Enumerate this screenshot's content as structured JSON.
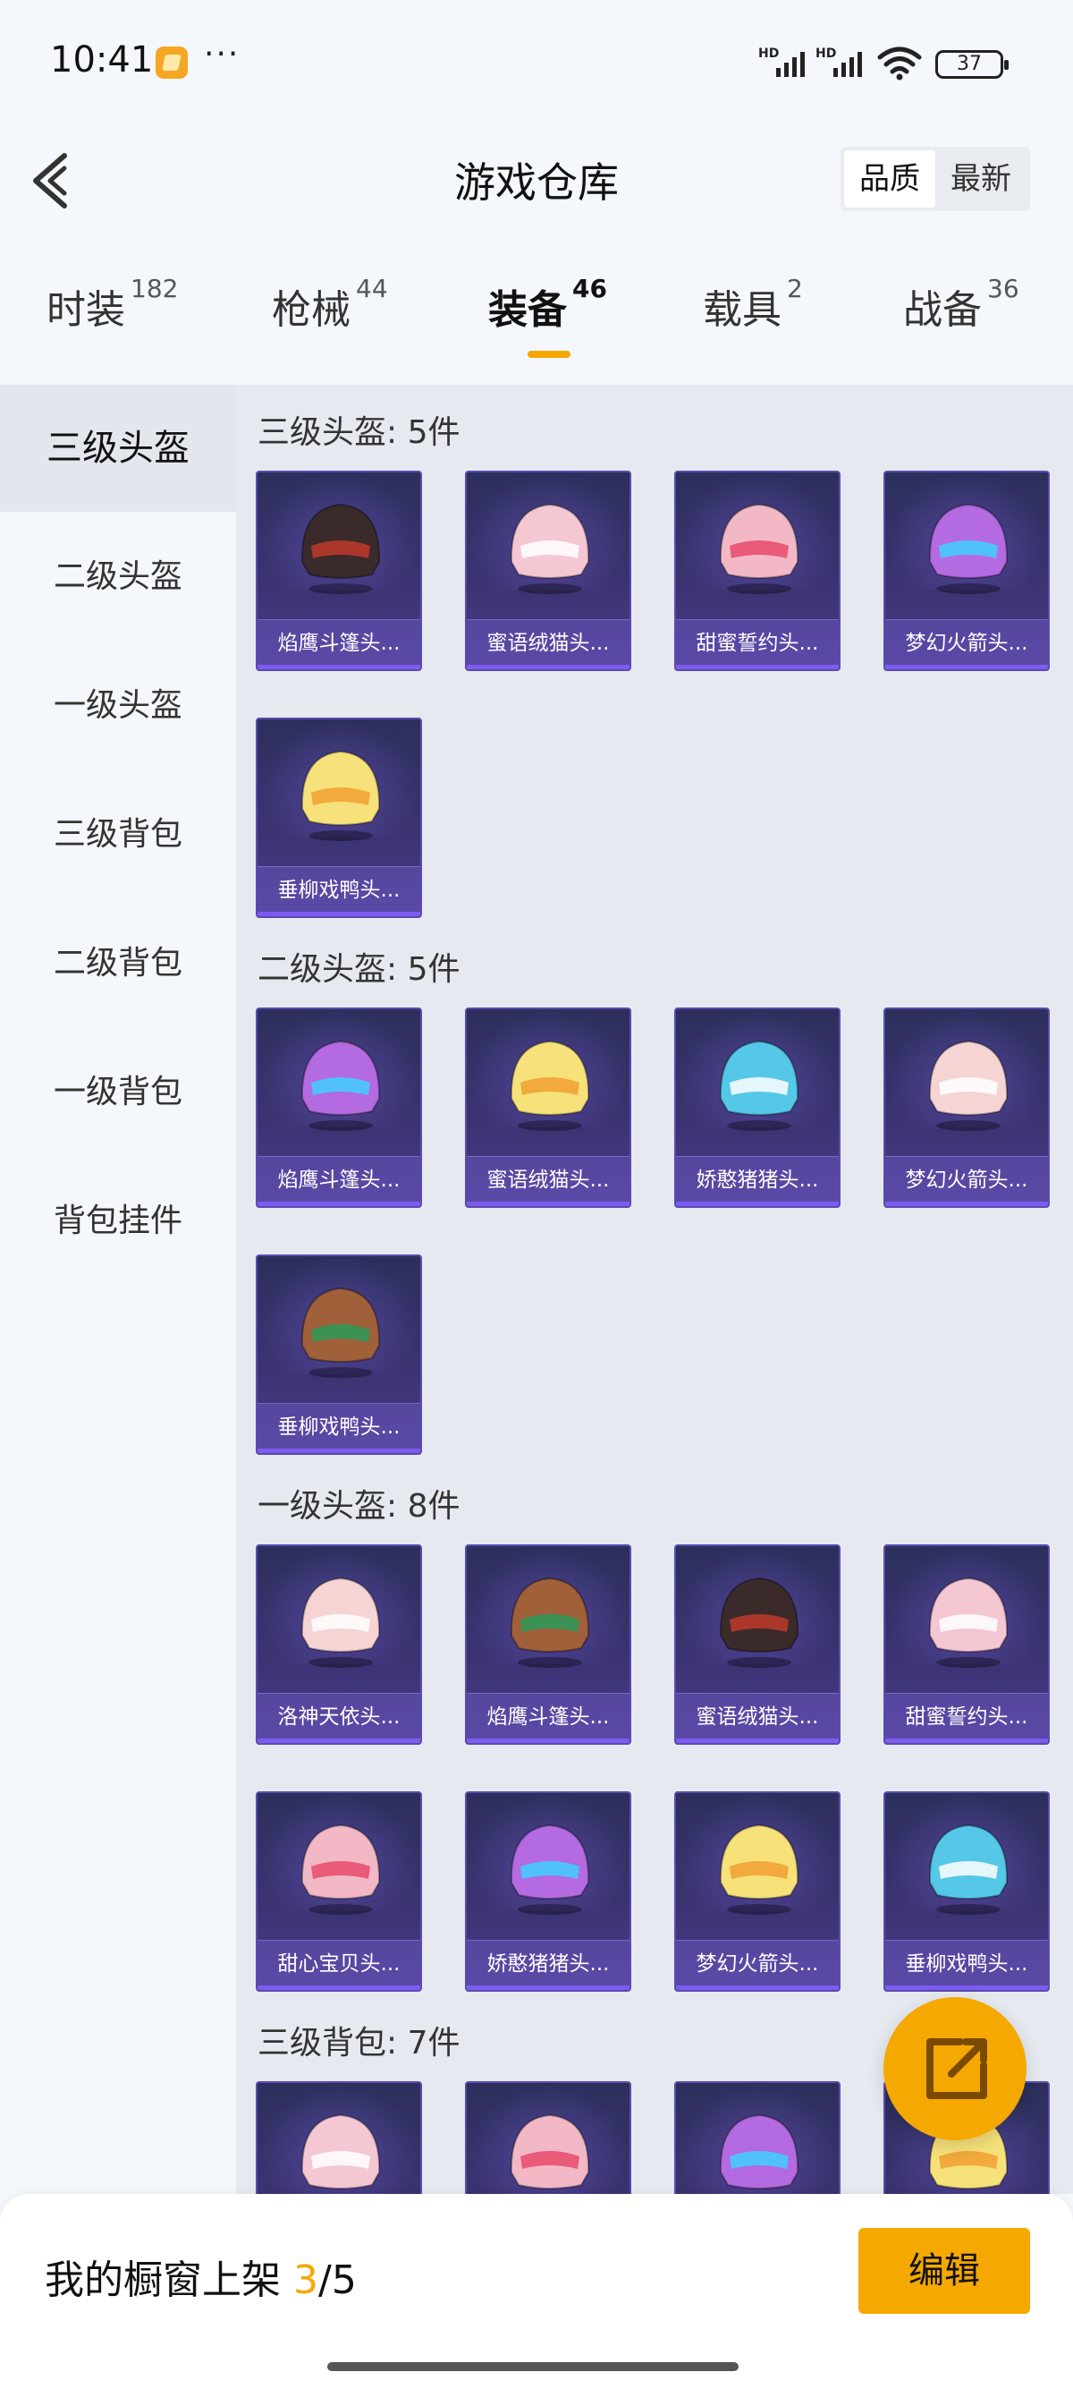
{
  "status_bar": {
    "time": "10:41",
    "more": "···",
    "signal_tag": "HD",
    "battery": "37"
  },
  "header": {
    "title": "游戏仓库",
    "sort_options": [
      "品质",
      "最新"
    ],
    "sort_active": "品质"
  },
  "tabs": [
    {
      "label": "时装",
      "count": "182"
    },
    {
      "label": "枪械",
      "count": "44"
    },
    {
      "label": "装备",
      "count": "46",
      "active": true
    },
    {
      "label": "载具",
      "count": "2"
    },
    {
      "label": "战备",
      "count": "36"
    }
  ],
  "sidebar": {
    "items": [
      "三级头盔",
      "二级头盔",
      "一级头盔",
      "三级背包",
      "二级背包",
      "一级背包",
      "背包挂件"
    ],
    "active": "三级头盔"
  },
  "sections": [
    {
      "title": "三级头盔: 5件",
      "items": [
        "焰鹰斗篷头...",
        "蜜语绒猫头...",
        "甜蜜誓约头...",
        "梦幻火箭头...",
        "垂柳戏鸭头..."
      ]
    },
    {
      "title": "二级头盔: 5件",
      "items": [
        "焰鹰斗篷头...",
        "蜜语绒猫头...",
        "娇憨猪猪头...",
        "梦幻火箭头...",
        "垂柳戏鸭头..."
      ]
    },
    {
      "title": "一级头盔: 8件",
      "items": [
        "洛神天依头...",
        "焰鹰斗篷头...",
        "蜜语绒猫头...",
        "甜蜜誓约头...",
        "甜心宝贝头...",
        "娇憨猪猪头...",
        "梦幻火箭头...",
        "垂柳戏鸭头..."
      ]
    },
    {
      "title": "三级背包: 7件",
      "items": [
        "",
        "",
        "",
        ""
      ]
    }
  ],
  "bottom_bar": {
    "label": "我的橱窗上架 ",
    "current": "3",
    "total": "/5",
    "edit_label": "编辑"
  },
  "colors": {
    "accent": "#f5a800",
    "card_bg": "#3a3370"
  }
}
